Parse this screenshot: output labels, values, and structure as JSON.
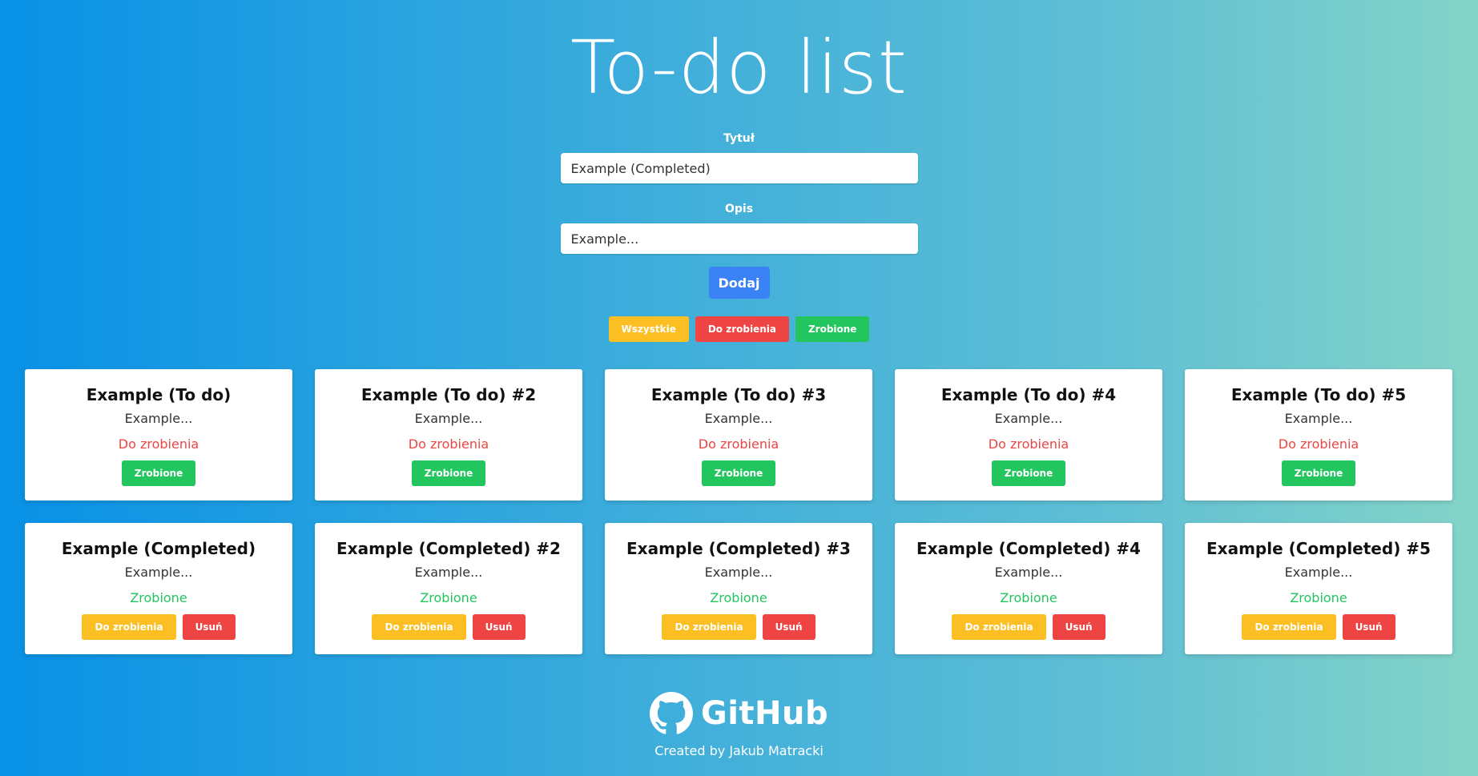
{
  "header": {
    "title": "To-do list"
  },
  "form": {
    "title_label": "Tytuł",
    "title_value": "Example (Completed)",
    "desc_label": "Opis",
    "desc_value": "Example...",
    "add_label": "Dodaj"
  },
  "filters": {
    "all": "Wszystkie",
    "todo": "Do zrobienia",
    "done": "Zrobione"
  },
  "todo_cards": [
    {
      "title": "Example (To do)",
      "desc": "Example...",
      "status": "Do zrobienia",
      "action": "Zrobione"
    },
    {
      "title": "Example (To do) #2",
      "desc": "Example...",
      "status": "Do zrobienia",
      "action": "Zrobione"
    },
    {
      "title": "Example (To do) #3",
      "desc": "Example...",
      "status": "Do zrobienia",
      "action": "Zrobione"
    },
    {
      "title": "Example (To do) #4",
      "desc": "Example...",
      "status": "Do zrobienia",
      "action": "Zrobione"
    },
    {
      "title": "Example (To do) #5",
      "desc": "Example...",
      "status": "Do zrobienia",
      "action": "Zrobione"
    }
  ],
  "done_cards": [
    {
      "title": "Example (Completed)",
      "desc": "Example...",
      "status": "Zrobione",
      "action": "Do zrobienia",
      "delete": "Usuń"
    },
    {
      "title": "Example (Completed) #2",
      "desc": "Example...",
      "status": "Zrobione",
      "action": "Do zrobienia",
      "delete": "Usuń"
    },
    {
      "title": "Example (Completed) #3",
      "desc": "Example...",
      "status": "Zrobione",
      "action": "Do zrobienia",
      "delete": "Usuń"
    },
    {
      "title": "Example (Completed) #4",
      "desc": "Example...",
      "status": "Zrobione",
      "action": "Do zrobienia",
      "delete": "Usuń"
    },
    {
      "title": "Example (Completed) #5",
      "desc": "Example...",
      "status": "Zrobione",
      "action": "Do zrobienia",
      "delete": "Usuń"
    }
  ],
  "footer": {
    "github_label": "GitHub",
    "github_icon": "github-icon",
    "credit": "Created by Jakub Matracki"
  },
  "colors": {
    "yellow": "#fbbf24",
    "red": "#ef4444",
    "green": "#22c55e",
    "blue": "#3b82f6"
  }
}
